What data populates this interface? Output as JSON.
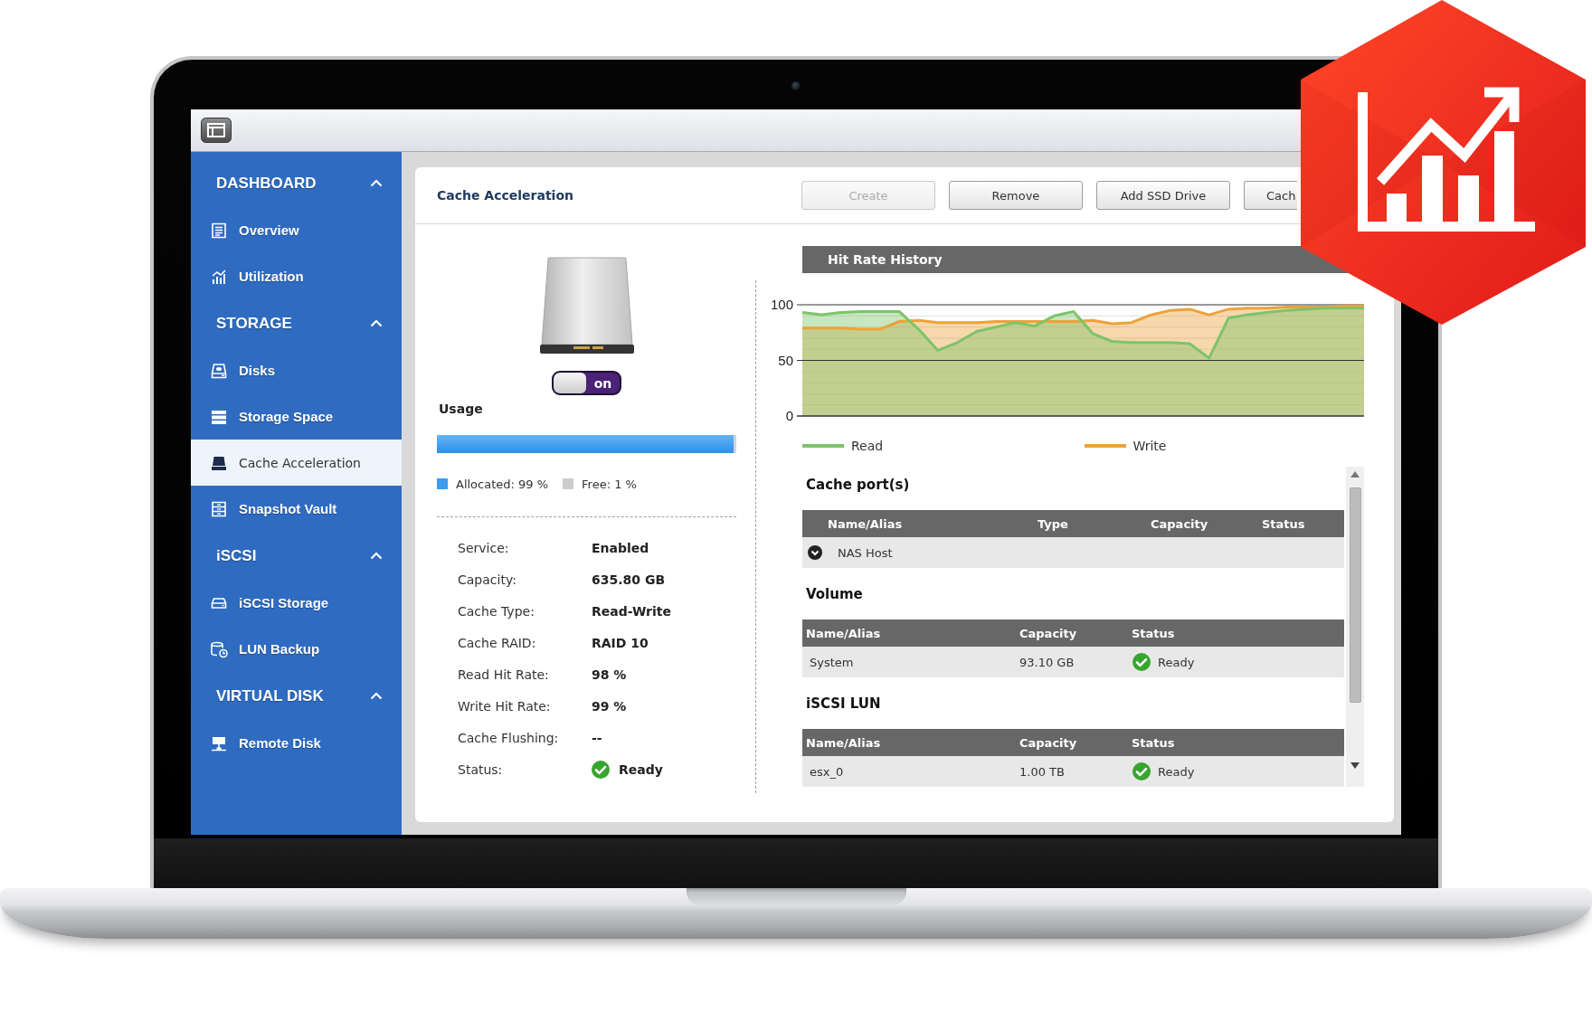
{
  "sidebar": {
    "sections": [
      {
        "title": "DASHBOARD",
        "expanded": true,
        "items": [
          {
            "label": "Overview",
            "selected": false
          },
          {
            "label": "Utilization",
            "selected": false
          }
        ]
      },
      {
        "title": "STORAGE",
        "expanded": true,
        "items": [
          {
            "label": "Disks",
            "selected": false
          },
          {
            "label": "Storage Space",
            "selected": false
          },
          {
            "label": "Cache Acceleration",
            "selected": true
          },
          {
            "label": "Snapshot Vault",
            "selected": false
          }
        ]
      },
      {
        "title": "iSCSI",
        "expanded": true,
        "items": [
          {
            "label": "iSCSI Storage",
            "selected": false
          },
          {
            "label": "LUN Backup",
            "selected": false
          }
        ]
      },
      {
        "title": "VIRTUAL DISK",
        "expanded": true,
        "items": [
          {
            "label": "Remote Disk",
            "selected": false
          }
        ]
      }
    ]
  },
  "panel": {
    "title": "Cache Acceleration",
    "buttons": [
      {
        "label": "Create",
        "disabled": true
      },
      {
        "label": "Remove",
        "disabled": false
      },
      {
        "label": "Add SSD Drive",
        "disabled": false
      },
      {
        "label": "Cach",
        "disabled": false
      }
    ]
  },
  "cache_device": {
    "switch": {
      "label": "on",
      "on": true
    },
    "usage": {
      "title": "Usage",
      "level": 0.99,
      "legend": [
        {
          "label": "Allocated: 99 %",
          "color": "#3d9be9"
        },
        {
          "label": "Free: 1 %",
          "color": "#cccccc"
        }
      ]
    },
    "details": [
      {
        "kind": "text",
        "label": "Service:",
        "value": "Enabled"
      },
      {
        "kind": "text",
        "label": "Capacity:",
        "value": "635.80 GB"
      },
      {
        "kind": "text",
        "label": "Cache Type:",
        "value": "Read-Write"
      },
      {
        "kind": "text",
        "label": "Cache RAID:",
        "value": "RAID 10"
      },
      {
        "kind": "text",
        "label": "Read Hit Rate:",
        "value": "98 %"
      },
      {
        "kind": "text",
        "label": "Write Hit Rate:",
        "value": "99 %"
      },
      {
        "kind": "text",
        "label": "Cache Flushing:",
        "value": "--"
      },
      {
        "kind": "status",
        "label": "Status:",
        "value": "Ready"
      }
    ]
  },
  "hit_rate_history": {
    "chart_data": {
      "type": "area",
      "title": "Hit Rate History",
      "legend": "bottom",
      "ylim": [
        0,
        100
      ],
      "yticks": [
        0,
        50,
        100
      ],
      "series": [
        {
          "name": "Read",
          "color": "#7cc46a",
          "values": [
            93,
            91,
            93,
            94,
            94,
            94,
            78,
            59,
            66,
            76,
            80,
            84,
            81,
            90,
            94,
            74,
            67,
            66,
            66,
            66,
            65,
            52,
            88,
            91,
            93,
            95,
            96,
            97,
            97,
            97
          ]
        },
        {
          "name": "Write",
          "color": "#eda23a",
          "values": [
            79,
            79,
            79,
            78,
            78,
            85,
            86,
            84,
            84,
            84,
            85,
            85,
            85,
            85,
            85,
            86,
            83,
            84,
            91,
            95,
            96,
            91,
            96,
            97,
            97,
            98,
            98,
            98,
            99,
            99
          ]
        }
      ]
    }
  },
  "tables": [
    {
      "title": "Cache port(s)",
      "columns": [
        "Name/Alias",
        "Type",
        "Capacity",
        "Status"
      ],
      "rows": [
        {
          "kind": "group",
          "cells": [
            "NAS Host"
          ]
        }
      ]
    },
    {
      "title": "Volume",
      "columns": [
        "Name/Alias",
        "Capacity",
        "Status"
      ],
      "rows": [
        {
          "kind": "item",
          "cells": [
            "System",
            "93.10 GB"
          ],
          "status": "Ready"
        }
      ]
    },
    {
      "title": "iSCSI LUN",
      "columns": [
        "Name/Alias",
        "Capacity",
        "Status"
      ],
      "rows": [
        {
          "kind": "item",
          "cells": [
            "esx_0",
            "1.00 TB"
          ],
          "status": "Ready"
        }
      ]
    }
  ]
}
